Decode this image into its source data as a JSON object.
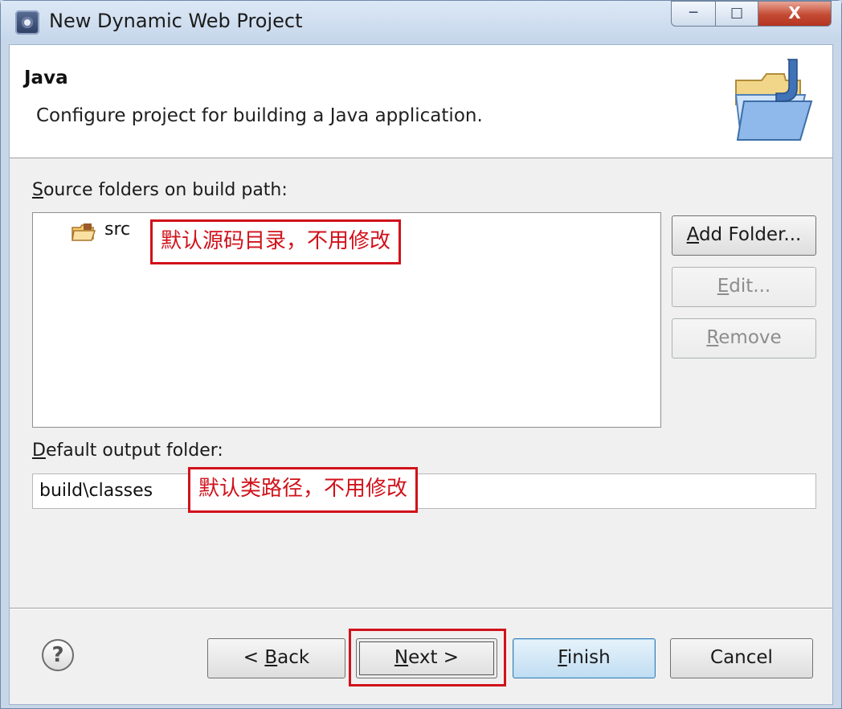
{
  "window": {
    "title": "New Dynamic Web Project",
    "controls": {
      "minimize": "─",
      "maximize": "□",
      "close": "X"
    }
  },
  "header": {
    "title": "Java",
    "description": "Configure project for building a Java application."
  },
  "source": {
    "label_accel": "S",
    "label_rest": "ource folders on build path:",
    "items": [
      {
        "label": "src",
        "icon": "package-folder-icon"
      }
    ],
    "annotation": "默认源码目录，不用修改"
  },
  "side_buttons": {
    "add_folder": {
      "accel": "A",
      "rest": "dd Folder...",
      "enabled": true
    },
    "edit": {
      "accel": "E",
      "rest": "dit...",
      "enabled": false
    },
    "remove": {
      "accel": "R",
      "rest": "emove",
      "enabled": false
    }
  },
  "output": {
    "label_accel": "D",
    "label_rest": "efault output folder:",
    "value": "build\\classes",
    "annotation": "默认类路径，不用修改"
  },
  "footer": {
    "help": "?",
    "back": {
      "prefix": "< ",
      "accel": "B",
      "rest": "ack"
    },
    "next": {
      "accel": "N",
      "rest": "ext >"
    },
    "finish": {
      "accel": "F",
      "rest": "inish"
    },
    "cancel": {
      "label": "Cancel"
    }
  },
  "colors": {
    "annotation_red": "#d0121b",
    "title_bar": "#c7d6e8",
    "focus_blue": "#3c7fb1"
  }
}
